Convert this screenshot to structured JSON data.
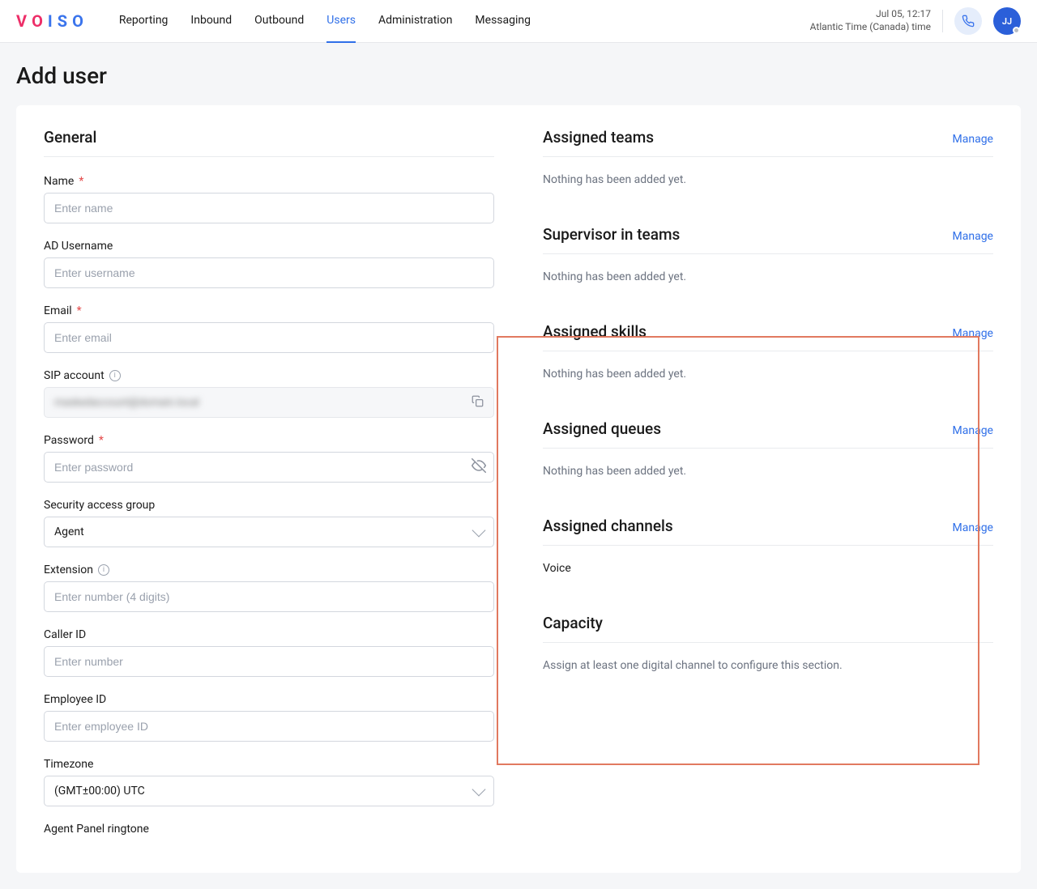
{
  "header": {
    "logo_letters": [
      "V",
      "O",
      "I",
      "S",
      "O"
    ],
    "nav": [
      "Reporting",
      "Inbound",
      "Outbound",
      "Users",
      "Administration",
      "Messaging"
    ],
    "active_nav_index": 3,
    "datetime": "Jul 05, 12:17",
    "timezone_label": "Atlantic Time (Canada) time",
    "avatar_initials": "JJ"
  },
  "page": {
    "title": "Add user"
  },
  "general": {
    "title": "General",
    "fields": {
      "name": {
        "label": "Name",
        "required": true,
        "placeholder": "Enter name"
      },
      "ad_username": {
        "label": "AD Username",
        "placeholder": "Enter username"
      },
      "email": {
        "label": "Email",
        "required": true,
        "placeholder": "Enter email"
      },
      "sip_account": {
        "label": "SIP account",
        "has_info": true,
        "masked_text": "maskedaccount@domain.local"
      },
      "password": {
        "label": "Password",
        "required": true,
        "placeholder": "Enter password"
      },
      "security_group": {
        "label": "Security access group",
        "value": "Agent"
      },
      "extension": {
        "label": "Extension",
        "has_info": true,
        "placeholder": "Enter number (4 digits)"
      },
      "caller_id": {
        "label": "Caller ID",
        "placeholder": "Enter number"
      },
      "employee_id": {
        "label": "Employee ID",
        "placeholder": "Enter employee ID"
      },
      "timezone": {
        "label": "Timezone",
        "value": "(GMT±00:00) UTC"
      },
      "ringtone": {
        "label": "Agent Panel ringtone"
      }
    }
  },
  "right": {
    "assigned_teams": {
      "title": "Assigned teams",
      "manage": "Manage",
      "empty": "Nothing has been added yet."
    },
    "supervisor_teams": {
      "title": "Supervisor in teams",
      "manage": "Manage",
      "empty": "Nothing has been added yet."
    },
    "assigned_skills": {
      "title": "Assigned skills",
      "manage": "Manage",
      "empty": "Nothing has been added yet."
    },
    "assigned_queues": {
      "title": "Assigned queues",
      "manage": "Manage",
      "empty": "Nothing has been added yet."
    },
    "assigned_channels": {
      "title": "Assigned channels",
      "manage": "Manage",
      "value": "Voice"
    },
    "capacity": {
      "title": "Capacity",
      "desc": "Assign at least one digital channel to configure this section."
    }
  }
}
